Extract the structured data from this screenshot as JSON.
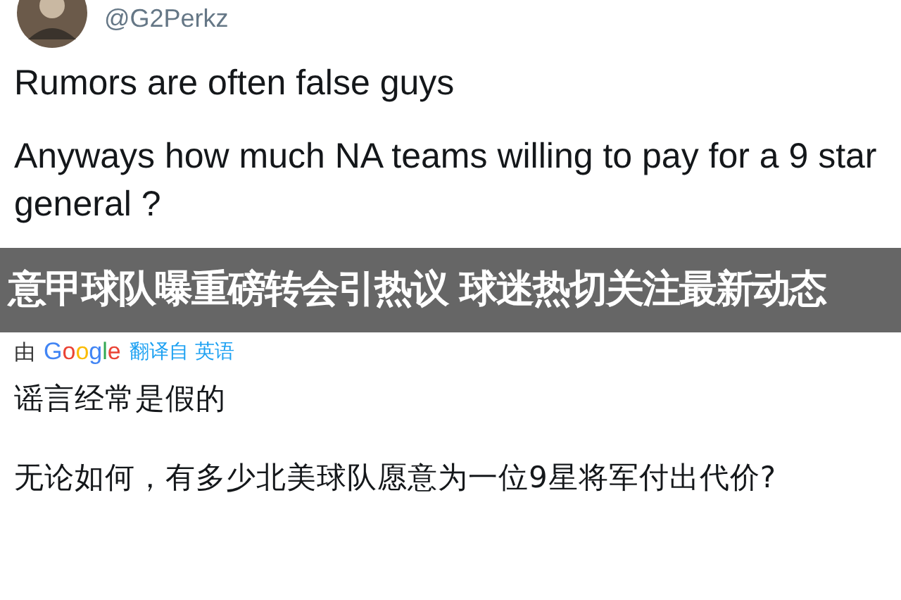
{
  "tweet": {
    "handle": "@G2Perkz",
    "paragraphs": [
      "Rumors are often false guys",
      "Anyways how much NA teams willing to pay for a 9 star general ?"
    ]
  },
  "banner": {
    "title": "意甲球队曝重磅转会引热议 球迷热切关注最新动态"
  },
  "translation": {
    "prefix": "由",
    "provider": "Google",
    "source": "翻译自 英语",
    "paragraphs": [
      "谣言经常是假的",
      "无论如何，有多少北美球队愿意为一位9星将军付出代价?"
    ]
  }
}
